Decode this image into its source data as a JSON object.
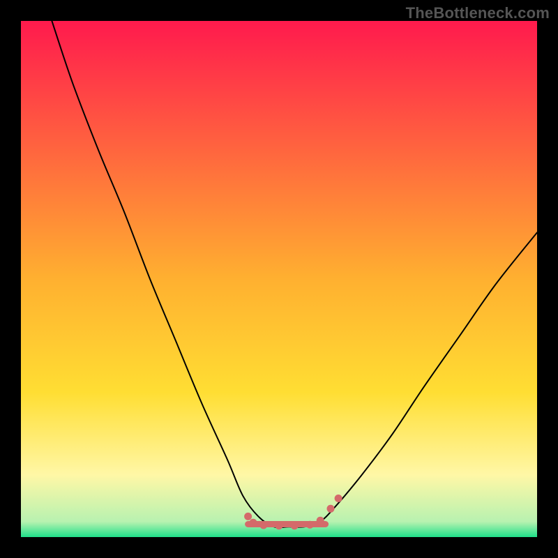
{
  "watermark": "TheBottleneck.com",
  "chart_data": {
    "type": "line",
    "title": "",
    "xlabel": "",
    "ylabel": "",
    "xlim": [
      0,
      100
    ],
    "ylim": [
      0,
      100
    ],
    "background_gradient": {
      "top": "#ff1a4d",
      "mid": "#ffde33",
      "lower": "#fff7a6",
      "bottom": "#1fe08a"
    },
    "series": [
      {
        "name": "bottleneck-curve",
        "color": "#000000",
        "x": [
          6,
          10,
          15,
          20,
          25,
          30,
          35,
          40,
          43,
          46,
          49,
          52,
          55,
          58,
          61,
          66,
          72,
          78,
          85,
          92,
          100
        ],
        "y": [
          100,
          88,
          75,
          63,
          50,
          38,
          26,
          15,
          8,
          4,
          2,
          2,
          2,
          3,
          6,
          12,
          20,
          29,
          39,
          49,
          59
        ]
      }
    ],
    "highlight": {
      "name": "flat-minimum-highlight",
      "color": "#d46a6a",
      "segment": {
        "x": [
          44,
          59
        ],
        "y": [
          2.5,
          2.5
        ]
      },
      "dots": [
        {
          "x": 44,
          "y": 4.0
        },
        {
          "x": 45,
          "y": 2.8
        },
        {
          "x": 47,
          "y": 2.3
        },
        {
          "x": 50,
          "y": 2.2
        },
        {
          "x": 53,
          "y": 2.2
        },
        {
          "x": 56,
          "y": 2.4
        },
        {
          "x": 58,
          "y": 3.2
        },
        {
          "x": 60,
          "y": 5.5
        },
        {
          "x": 61.5,
          "y": 7.5
        }
      ]
    }
  }
}
